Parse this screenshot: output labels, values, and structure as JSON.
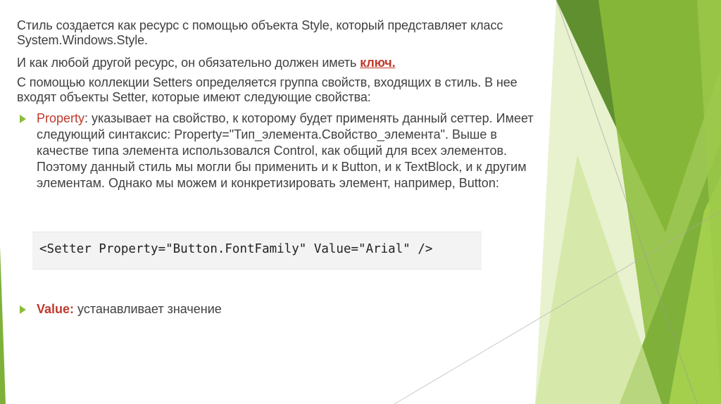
{
  "slide": {
    "paragraph1": "Стиль создается как ресурс с помощью объекта Style, который представляет класс System.Windows.Style.",
    "paragraph2_text": "И как любой другой ресурс, он обязательно должен иметь ",
    "paragraph2_link": "ключ.",
    "paragraph3": "С помощью коллекции Setters определяется группа свойств, входящих в стиль. В нее входят объекты Setter, которые имеют следующие свойства:",
    "bullets": [
      {
        "term": "Property",
        "text": ": указывает на свойство, к которому будет применять данный сеттер. Имеет следующий синтаксис: Property=\"Тип_элемента.Свойство_элемента\". Выше в качестве типа элемента использовался Control, как общий для всех элементов. Поэтому данный стиль мы могли бы применить и к Button, и к TextBlock, и к другим элементам. Однако мы можем и конкретизировать элемент, например, Button:"
      },
      {
        "term": "Value:",
        "text": " устанавливает значение"
      }
    ],
    "code": "<Setter Property=\"Button.FontFamily\" Value=\"Arial\" />"
  },
  "colors": {
    "text": "#404040",
    "accent_red": "#c0392b",
    "bullet_green": "#8cbd3a",
    "green_dark": "#6f9a2e",
    "green_light": "#b6d86a"
  },
  "icons": {
    "bullet_marker": "triangle-right"
  }
}
